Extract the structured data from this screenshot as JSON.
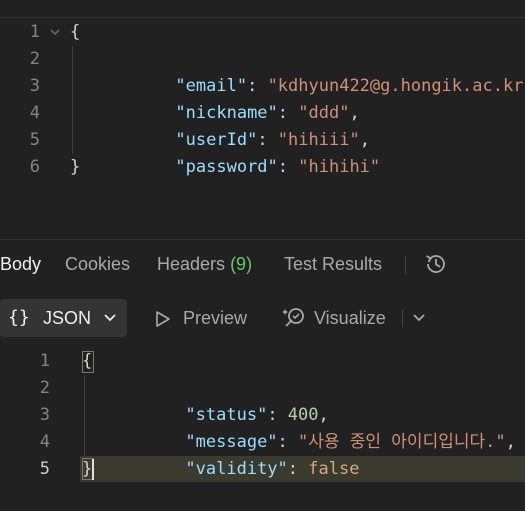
{
  "request_body": {
    "lines": [
      {
        "number": "1",
        "text": "{"
      },
      {
        "number": "2",
        "key": "\"email\"",
        "value": "\"kdhyun422@g.hongik.ac.kr\"",
        "trail": ","
      },
      {
        "number": "3",
        "key": "\"nickname\"",
        "value": "\"ddd\"",
        "trail": ","
      },
      {
        "number": "4",
        "key": "\"userId\"",
        "value": "\"hihiii\"",
        "trail": ","
      },
      {
        "number": "5",
        "key": "\"password\"",
        "value": "\"hihihi\"",
        "trail": ""
      },
      {
        "number": "6",
        "text": "}"
      }
    ]
  },
  "response_tabs": {
    "body": "Body",
    "cookies": "Cookies",
    "headers": "Headers",
    "headers_count": "(9)",
    "test_results": "Test Results"
  },
  "toolbar": {
    "format_label": "JSON",
    "braces": "{}",
    "preview": "Preview",
    "visualize": "Visualize"
  },
  "response_body": {
    "lines": [
      {
        "number": "1",
        "text": "{"
      },
      {
        "number": "2",
        "key": "\"status\"",
        "value": "400",
        "trail": ","
      },
      {
        "number": "3",
        "key": "\"message\"",
        "value": "\"사용 중인 아이디입니다.\"",
        "trail": ","
      },
      {
        "number": "4",
        "key": "\"validity\"",
        "value": "false",
        "trail": ""
      },
      {
        "number": "5",
        "text": "}"
      }
    ]
  },
  "colors": {
    "background": "#212121",
    "json_key": "#9cdcfe",
    "json_string": "#ce9178",
    "json_number": "#b5cea8",
    "count_green": "#6bc36b"
  },
  "icons": [
    "chevron-down-icon",
    "history-icon",
    "play-outline-icon",
    "visualize-icon"
  ]
}
